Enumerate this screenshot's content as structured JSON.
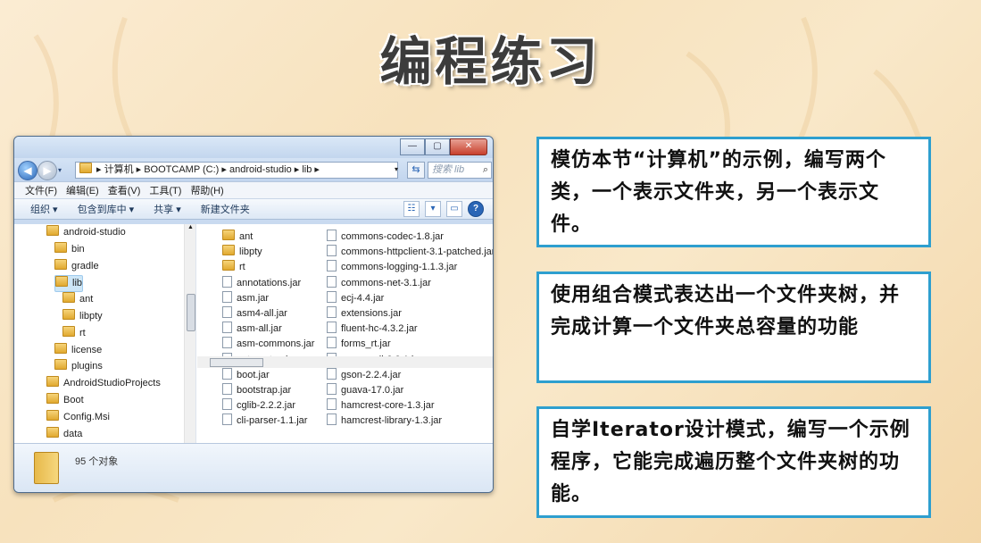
{
  "slide": {
    "title": "编程练习",
    "tasks": [
      "模仿本节“计算机”的示例，编写两个类，一个表示文件夹，另一个表示文件。",
      "使用组合模式表达出一个文件夹树，并完成计算一个文件夹总容量的功能",
      "自学Iterator设计模式，编写一个示例程序，它能完成遍历整个文件夹树的功能。"
    ]
  },
  "colors": {
    "box_border": "#2e9fcf",
    "accent": "#2a66b6"
  },
  "explorer": {
    "window_buttons": {
      "minimize": "—",
      "maximize": "▢",
      "close": "✕"
    },
    "address_path": "▸ 计算机 ▸ BOOTCAMP (C:) ▸ android-studio ▸ lib ▸",
    "search_placeholder": "搜索 lib",
    "menu": [
      "文件(F)",
      "编辑(E)",
      "查看(V)",
      "工具(T)",
      "帮助(H)"
    ],
    "toolbar": [
      "组织 ▾",
      "包含到库中 ▾",
      "共享 ▾",
      "新建文件夹"
    ],
    "nav_tree": [
      {
        "label": "android-studio",
        "indent": 0,
        "selected": false
      },
      {
        "label": "bin",
        "indent": 1,
        "selected": false
      },
      {
        "label": "gradle",
        "indent": 1,
        "selected": false
      },
      {
        "label": "lib",
        "indent": 1,
        "selected": true
      },
      {
        "label": "ant",
        "indent": 2,
        "selected": false
      },
      {
        "label": "libpty",
        "indent": 2,
        "selected": false
      },
      {
        "label": "rt",
        "indent": 2,
        "selected": false
      },
      {
        "label": "license",
        "indent": 1,
        "selected": false
      },
      {
        "label": "plugins",
        "indent": 1,
        "selected": false
      },
      {
        "label": "AndroidStudioProjects",
        "indent": 0,
        "selected": false
      },
      {
        "label": "Boot",
        "indent": 0,
        "selected": false
      },
      {
        "label": "Config.Msi",
        "indent": 0,
        "selected": false
      },
      {
        "label": "data",
        "indent": 0,
        "selected": false
      }
    ],
    "files_col1": [
      {
        "name": "ant",
        "type": "folder"
      },
      {
        "name": "libpty",
        "type": "folder"
      },
      {
        "name": "rt",
        "type": "folder"
      },
      {
        "name": "annotations.jar",
        "type": "file"
      },
      {
        "name": "asm.jar",
        "type": "file"
      },
      {
        "name": "asm4-all.jar",
        "type": "file"
      },
      {
        "name": "asm-all.jar",
        "type": "file"
      },
      {
        "name": "asm-commons.jar",
        "type": "file"
      },
      {
        "name": "automaton.jar",
        "type": "file"
      },
      {
        "name": "boot.jar",
        "type": "file"
      },
      {
        "name": "bootstrap.jar",
        "type": "file"
      },
      {
        "name": "cglib-2.2.2.jar",
        "type": "file"
      },
      {
        "name": "cli-parser-1.1.jar",
        "type": "file"
      }
    ],
    "files_col2": [
      {
        "name": "commons-codec-1.8.jar",
        "type": "file"
      },
      {
        "name": "commons-httpclient-3.1-patched.jar",
        "type": "file"
      },
      {
        "name": "commons-logging-1.1.3.jar",
        "type": "file"
      },
      {
        "name": "commons-net-3.1.jar",
        "type": "file"
      },
      {
        "name": "ecj-4.4.jar",
        "type": "file"
      },
      {
        "name": "extensions.jar",
        "type": "file"
      },
      {
        "name": "fluent-hc-4.3.2.jar",
        "type": "file"
      },
      {
        "name": "forms_rt.jar",
        "type": "file"
      },
      {
        "name": "groovy-all-2.2.1.jar",
        "type": "file"
      },
      {
        "name": "gson-2.2.4.jar",
        "type": "file"
      },
      {
        "name": "guava-17.0.jar",
        "type": "file"
      },
      {
        "name": "hamcrest-core-1.3.jar",
        "type": "file"
      },
      {
        "name": "hamcrest-library-1.3.jar",
        "type": "file"
      }
    ],
    "status_count": "95 个对象"
  }
}
